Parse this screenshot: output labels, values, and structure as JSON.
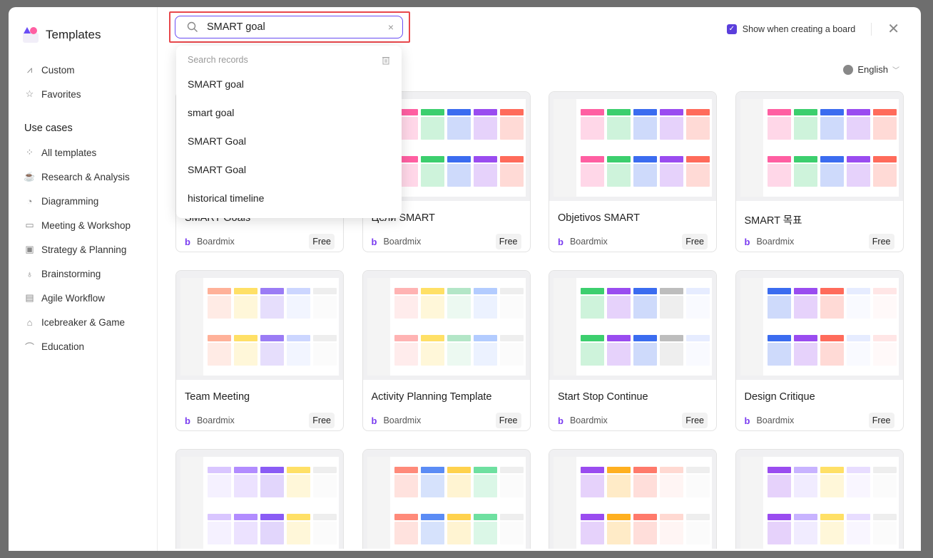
{
  "brand": {
    "title": "Templates"
  },
  "sidebar": {
    "top_items": [
      {
        "label": "Custom",
        "icon": "chart-icon"
      },
      {
        "label": "Favorites",
        "icon": "star-icon"
      }
    ],
    "section_title": "Use cases",
    "items": [
      {
        "label": "All templates",
        "icon": "grid-icon"
      },
      {
        "label": "Research & Analysis",
        "icon": "cup-icon"
      },
      {
        "label": "Diagramming",
        "icon": "pie-icon"
      },
      {
        "label": "Meeting & Workshop",
        "icon": "board-icon"
      },
      {
        "label": "Strategy & Planning",
        "icon": "briefcase-icon"
      },
      {
        "label": "Brainstorming",
        "icon": "bulb-icon"
      },
      {
        "label": "Agile Workflow",
        "icon": "clipboard-icon"
      },
      {
        "label": "Icebreaker & Game",
        "icon": "lock-icon"
      },
      {
        "label": "Education",
        "icon": "cap-icon"
      }
    ]
  },
  "search": {
    "value": "SMART goal",
    "clear_icon": "×"
  },
  "dropdown": {
    "header": "Search records",
    "items": [
      "SMART goal",
      "smart goal",
      "SMART Goal",
      "SMART Goal",
      "historical timeline"
    ]
  },
  "header": {
    "show_label": "Show when creating a board",
    "show_checked": true,
    "language": "English"
  },
  "accent": "#5b3fdc",
  "cards": [
    {
      "title": "SMART Goals",
      "author": "Boardmix",
      "badge": "Free",
      "colors": [
        "#ff5fa2",
        "#3ccf6e",
        "#3b6cf0",
        "#9a4cf0",
        "#ff6b5b"
      ]
    },
    {
      "title": "Цели SMART",
      "author": "Boardmix",
      "badge": "Free",
      "colors": [
        "#ff5fa2",
        "#3ccf6e",
        "#3b6cf0",
        "#9a4cf0",
        "#ff6b5b"
      ]
    },
    {
      "title": "Objetivos SMART",
      "author": "Boardmix",
      "badge": "Free",
      "colors": [
        "#ff5fa2",
        "#3ccf6e",
        "#3b6cf0",
        "#9a4cf0",
        "#ff6b5b"
      ]
    },
    {
      "title": "SMART 목표",
      "author": "Boardmix",
      "badge": "Free",
      "colors": [
        "#ff5fa2",
        "#3ccf6e",
        "#3b6cf0",
        "#9a4cf0",
        "#ff6b5b"
      ]
    },
    {
      "title": "Team Meeting",
      "author": "Boardmix",
      "badge": "Free",
      "colors": [
        "#ffb199",
        "#ffe066",
        "#9b7cf5",
        "#ccd6ff",
        "#eeeeee"
      ]
    },
    {
      "title": "Activity Planning Template",
      "author": "Boardmix",
      "badge": "Free",
      "colors": [
        "#ffb3b3",
        "#ffe066",
        "#b3e6c7",
        "#b3ccff",
        "#eeeeee"
      ]
    },
    {
      "title": "Start Stop Continue",
      "author": "Boardmix",
      "badge": "Free",
      "colors": [
        "#3ccf6e",
        "#9a4cf0",
        "#3b6cf0",
        "#bdbdbd",
        "#e6ecff"
      ]
    },
    {
      "title": "Design Critique",
      "author": "Boardmix",
      "badge": "Free",
      "colors": [
        "#3b6cf0",
        "#9a4cf0",
        "#ff6b5b",
        "#e6ecff",
        "#ffe6e6"
      ]
    },
    {
      "title": "",
      "author": "",
      "badge": "",
      "colors": [
        "#d9c6ff",
        "#b28cff",
        "#8a5cf5",
        "#ffe066",
        "#eeeeee"
      ]
    },
    {
      "title": "",
      "author": "",
      "badge": "",
      "colors": [
        "#ff8a7a",
        "#5b8cf5",
        "#ffd24d",
        "#6ee0a0",
        "#eeeeee"
      ]
    },
    {
      "title": "",
      "author": "",
      "badge": "",
      "colors": [
        "#9a4cf0",
        "#ffb020",
        "#ff7a6b",
        "#ffd9d2",
        "#eeeeee"
      ]
    },
    {
      "title": "",
      "author": "",
      "badge": "",
      "colors": [
        "#9a4cf0",
        "#c8b3ff",
        "#ffe066",
        "#e8ddff",
        "#eeeeee"
      ]
    }
  ]
}
